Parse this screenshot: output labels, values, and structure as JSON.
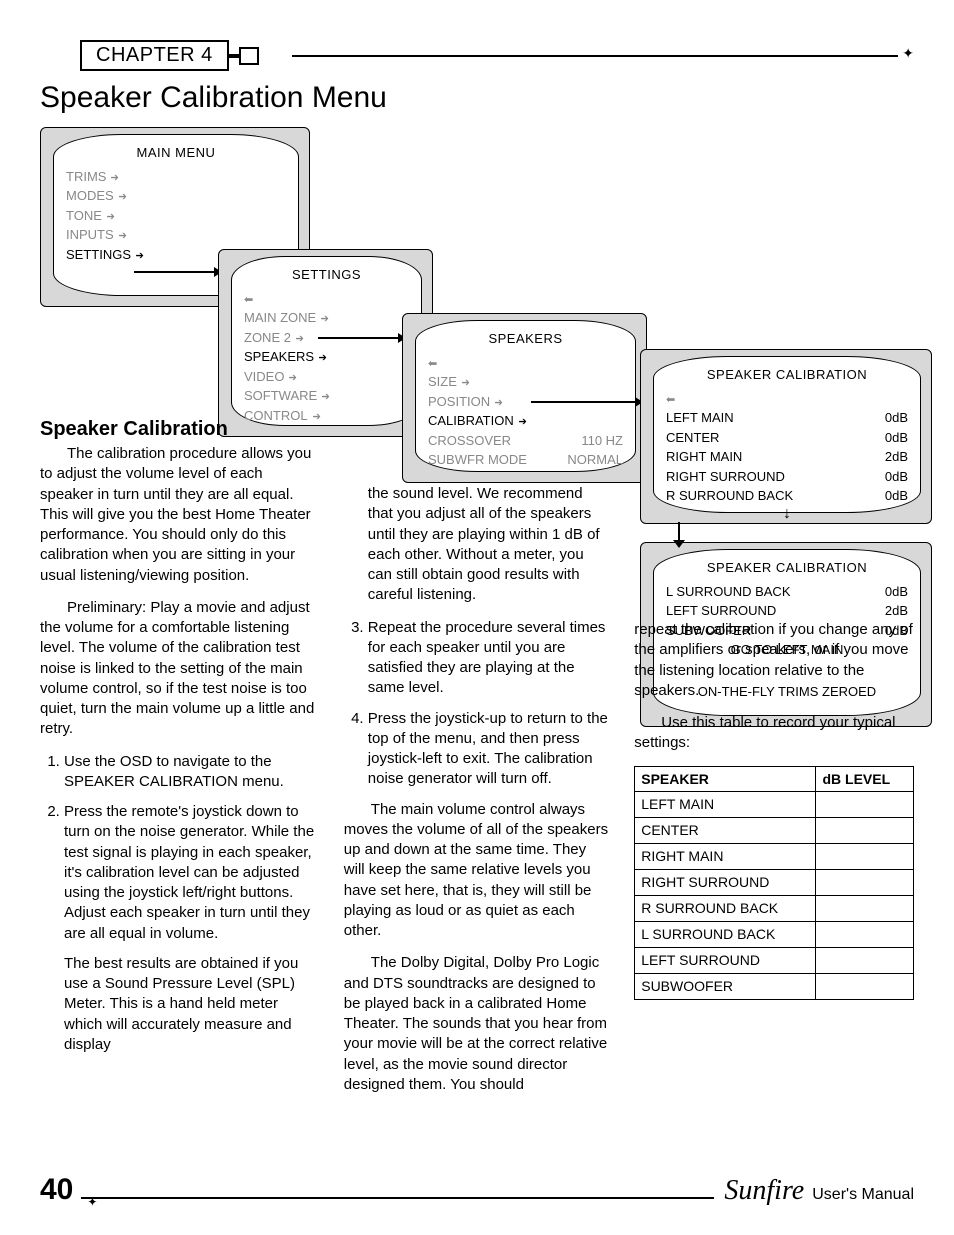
{
  "chapter": "CHAPTER 4",
  "title": "Speaker Calibration Menu",
  "subheading": "Speaker Calibration",
  "menus": {
    "main": {
      "title": "MAIN MENU",
      "items": [
        {
          "label": "TRIMS",
          "dim": true
        },
        {
          "label": "MODES",
          "dim": true
        },
        {
          "label": "TONE",
          "dim": true
        },
        {
          "label": "INPUTS",
          "dim": true
        },
        {
          "label": "SETTINGS",
          "dim": false
        }
      ]
    },
    "settings": {
      "title": "SETTINGS",
      "items": [
        {
          "label": "MAIN ZONE",
          "dim": true
        },
        {
          "label": "ZONE 2",
          "dim": true
        },
        {
          "label": "SPEAKERS",
          "dim": false
        },
        {
          "label": "VIDEO",
          "dim": true
        },
        {
          "label": "SOFTWARE",
          "dim": true
        },
        {
          "label": "CONTROL",
          "dim": true
        }
      ]
    },
    "speakers": {
      "title": "SPEAKERS",
      "items": [
        {
          "label": "SIZE",
          "value": "",
          "dim": true,
          "arrow": true
        },
        {
          "label": "POSITION",
          "value": "",
          "dim": true,
          "arrow": true
        },
        {
          "label": "CALIBRATION",
          "value": "",
          "dim": false,
          "arrow": true
        },
        {
          "label": "CROSSOVER",
          "value": "110  HZ",
          "dim": true,
          "arrow": false
        },
        {
          "label": "SUBWFR MODE",
          "value": "NORMAL",
          "dim": true,
          "arrow": false
        }
      ]
    },
    "calibration1": {
      "title": "SPEAKER CALIBRATION",
      "items": [
        {
          "label": "LEFT MAIN",
          "value": "0dB"
        },
        {
          "label": "CENTER",
          "value": "0dB"
        },
        {
          "label": "RIGHT MAIN",
          "value": "2dB"
        },
        {
          "label": "RIGHT SURROUND",
          "value": "0dB"
        },
        {
          "label": "R SURROUND BACK",
          "value": "0dB"
        }
      ]
    },
    "calibration2": {
      "title": "SPEAKER CALIBRATION",
      "items": [
        {
          "label": "L SURROUND BACK",
          "value": "0dB"
        },
        {
          "label": "LEFT SURROUND",
          "value": "2dB"
        },
        {
          "label": "SUBWOOFER",
          "value": "0dB"
        }
      ],
      "goto": "GO TO LEFT MAIN",
      "footer": "ON-THE-FLY TRIMS ZEROED"
    }
  },
  "body": {
    "p1": "The calibration procedure allows you to adjust the volume level of each speaker in turn until they are all equal. This will give you the best Home Theater performance. You should only do this calibration when you are sitting in your usual listening/viewing position.",
    "p2": "Preliminary: Play a movie and adjust the volume for a comfortable listening level. The volume of the calibration test noise is linked to the setting of the main volume control, so if the test noise is too quiet, turn the main volume up a little and retry.",
    "steps": {
      "s1": "Use the OSD to navigate to the SPEAKER CALIBRATION menu.",
      "s2": "Press the remote's joystick down to turn on the noise generator. While the test signal is playing in each speaker, it's calibration level can be adjusted using the joystick left/right buttons. Adjust each speaker in turn until they are all equal in volume.",
      "s2b": "The best results are obtained if you use a Sound Pressure Level (SPL) Meter. This is a hand held meter which will accurately measure and display",
      "s2c": "the sound level. We recommend that you adjust all of the speakers until they are playing within 1 dB of each other. Without a meter, you can still obtain good results with careful listening.",
      "s3": "Repeat the procedure several times for each speaker until you are satisfied they are playing at the same level.",
      "s4": "Press the joystick-up to return to the top of the menu, and then press joystick-left to exit. The calibration noise generator will turn off."
    },
    "p3": "The main volume control always moves the volume of all of the speakers up and down at the same time. They will keep the same relative levels you have set here, that is, they will still be playing as loud or as quiet as each other.",
    "p4": "The Dolby Digital, Dolby Pro Logic and DTS soundtracks are designed to be played back in a calibrated Home Theater. The sounds that you hear from your movie will be at the correct relative level, as the movie sound director designed them. You should",
    "p5": "repeat the calibration if you change any of the amplifiers or speakers, or if you move the listening location relative to the speakers.",
    "p6": "Use this table to record your typical settings:"
  },
  "table": {
    "headers": {
      "speaker": "SPEAKER",
      "db": "dB LEVEL"
    },
    "rows": [
      "LEFT MAIN",
      "CENTER",
      "RIGHT MAIN",
      "RIGHT SURROUND",
      "R SURROUND BACK",
      "L SURROUND BACK",
      "LEFT SURROUND",
      "SUBWOOFER"
    ]
  },
  "footer": {
    "page": "40",
    "brand": "Sunfire",
    "manual": "User's Manual"
  }
}
